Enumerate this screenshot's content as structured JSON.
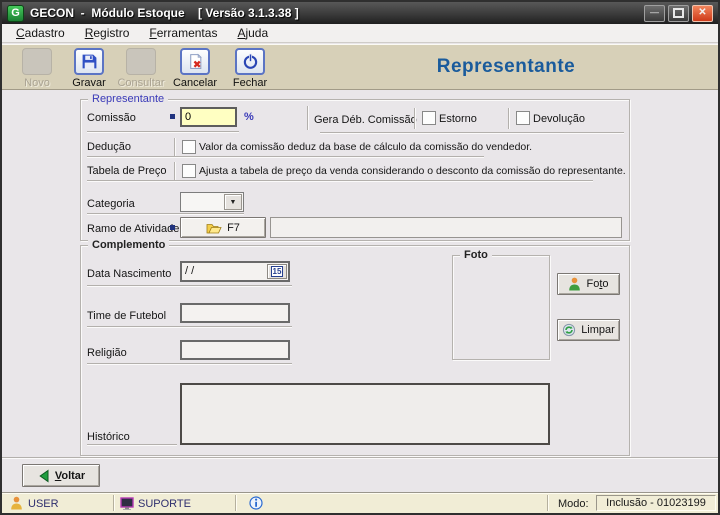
{
  "window": {
    "title": "GECON  -  Módulo Estoque    [ Versão 3.1.3.38 ]",
    "icon_letter": "G",
    "minimize_glyph": "—",
    "close_glyph": "✕"
  },
  "menu": {
    "items": [
      {
        "key": "C",
        "post": "adastro"
      },
      {
        "key": "R",
        "post": "egistro"
      },
      {
        "key": "F",
        "post": "erramentas"
      },
      {
        "key": "A",
        "post": "juda"
      }
    ]
  },
  "toolbar": {
    "page_title": "Representante",
    "buttons": [
      {
        "label": "Novo",
        "state": "disabled"
      },
      {
        "label": "Gravar",
        "state": "enabled"
      },
      {
        "label": "Consultar",
        "state": "disabled"
      },
      {
        "label": "Cancelar",
        "state": "enabled"
      },
      {
        "label": "Fechar",
        "state": "enabled"
      }
    ]
  },
  "form": {
    "representante": {
      "group_title": "Representante",
      "comissao_label": "Comissão",
      "comissao_value": "0",
      "percent_sign": "%",
      "gera_deb_label": "Gera Déb. Comissão",
      "estorno_label": "Estorno",
      "devolucao_label": "Devolução",
      "deducao_label": "Dedução",
      "deducao_text": "Valor da comissão deduz da base de cálculo da comissão do vendedor.",
      "tabela_label": "Tabela de Preço",
      "tabela_text": "Ajusta a tabela de preço da venda considerando o desconto da comissão do representante.",
      "categoria_label": "Categoria",
      "ramo_label": "Ramo de Atividade",
      "ramo_button": "F7",
      "ramo_value": ""
    },
    "complemento": {
      "group_title": "Complemento",
      "data_nascimento_label": "Data Nascimento",
      "data_nascimento_value": "/ /",
      "calendar_glyph": "15",
      "time_futebol_label": "Time de Futebol",
      "time_futebol_value": "",
      "religiao_label": "Religião",
      "religiao_value": "",
      "historico_label": "Histórico",
      "historico_value": "",
      "foto_group_title": "Foto",
      "foto_button": {
        "pre": "Fo",
        "key": "t",
        "post": "o"
      },
      "limpar_button": "Limpar"
    },
    "voltar_button": {
      "key": "V",
      "post": "oltar"
    }
  },
  "statusbar": {
    "user": "USER",
    "support": "SUPORTE",
    "modo_label": "Modo:",
    "modo_value": "Inclusão - 01023199"
  },
  "colors": {
    "page_title_blue": "#1a5b9c",
    "group_label_blue": "#3a3ab8",
    "toolbar_bg": "#d7d0b8",
    "comissao_field_yellow": "#ffffc2",
    "statusbar_bg": "#f1edd6"
  }
}
